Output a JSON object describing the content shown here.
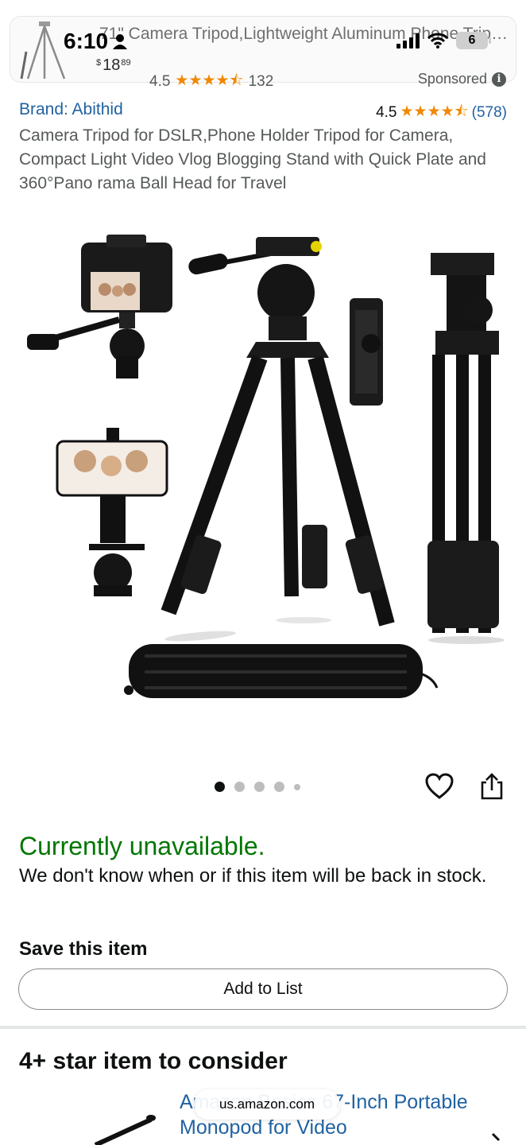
{
  "status_bar": {
    "time": "6:10",
    "battery": "6"
  },
  "sponsored_ad": {
    "title": "71\" Camera Tripod,Lightweight Aluminum Phone Tripod...",
    "price_symbol": "$",
    "price_whole": "18",
    "price_fraction": "89",
    "rating": "4.5",
    "stars": "★★★★⯪",
    "review_count": "132",
    "sponsored_label": "Sponsored"
  },
  "product": {
    "brand": "Brand: Abithid",
    "rating": "4.5",
    "stars": "★★★★⯪",
    "review_count": "(578)",
    "title": "Camera Tripod for DSLR,Phone Holder Tripod for Camera, Compact Light Video Vlog Blogging Stand with Quick Plate and 360°Pano rama Ball Head for Travel"
  },
  "image_carousel": {
    "total": 5,
    "active_index": 1
  },
  "availability": {
    "status": "Currently unavailable.",
    "message": "We don't know when or if this item will be back in stock."
  },
  "save": {
    "label": "Save this item",
    "button": "Add to List"
  },
  "recommendations": {
    "title": "4+ star item to consider",
    "item_title": "Amazon Basics 67-Inch Portable Monopod for Video"
  },
  "browser": {
    "url": "us.amazon.com"
  },
  "colors": {
    "brand_link": "#2162a1",
    "star": "#f08804",
    "in_stock_green": "#007600"
  }
}
